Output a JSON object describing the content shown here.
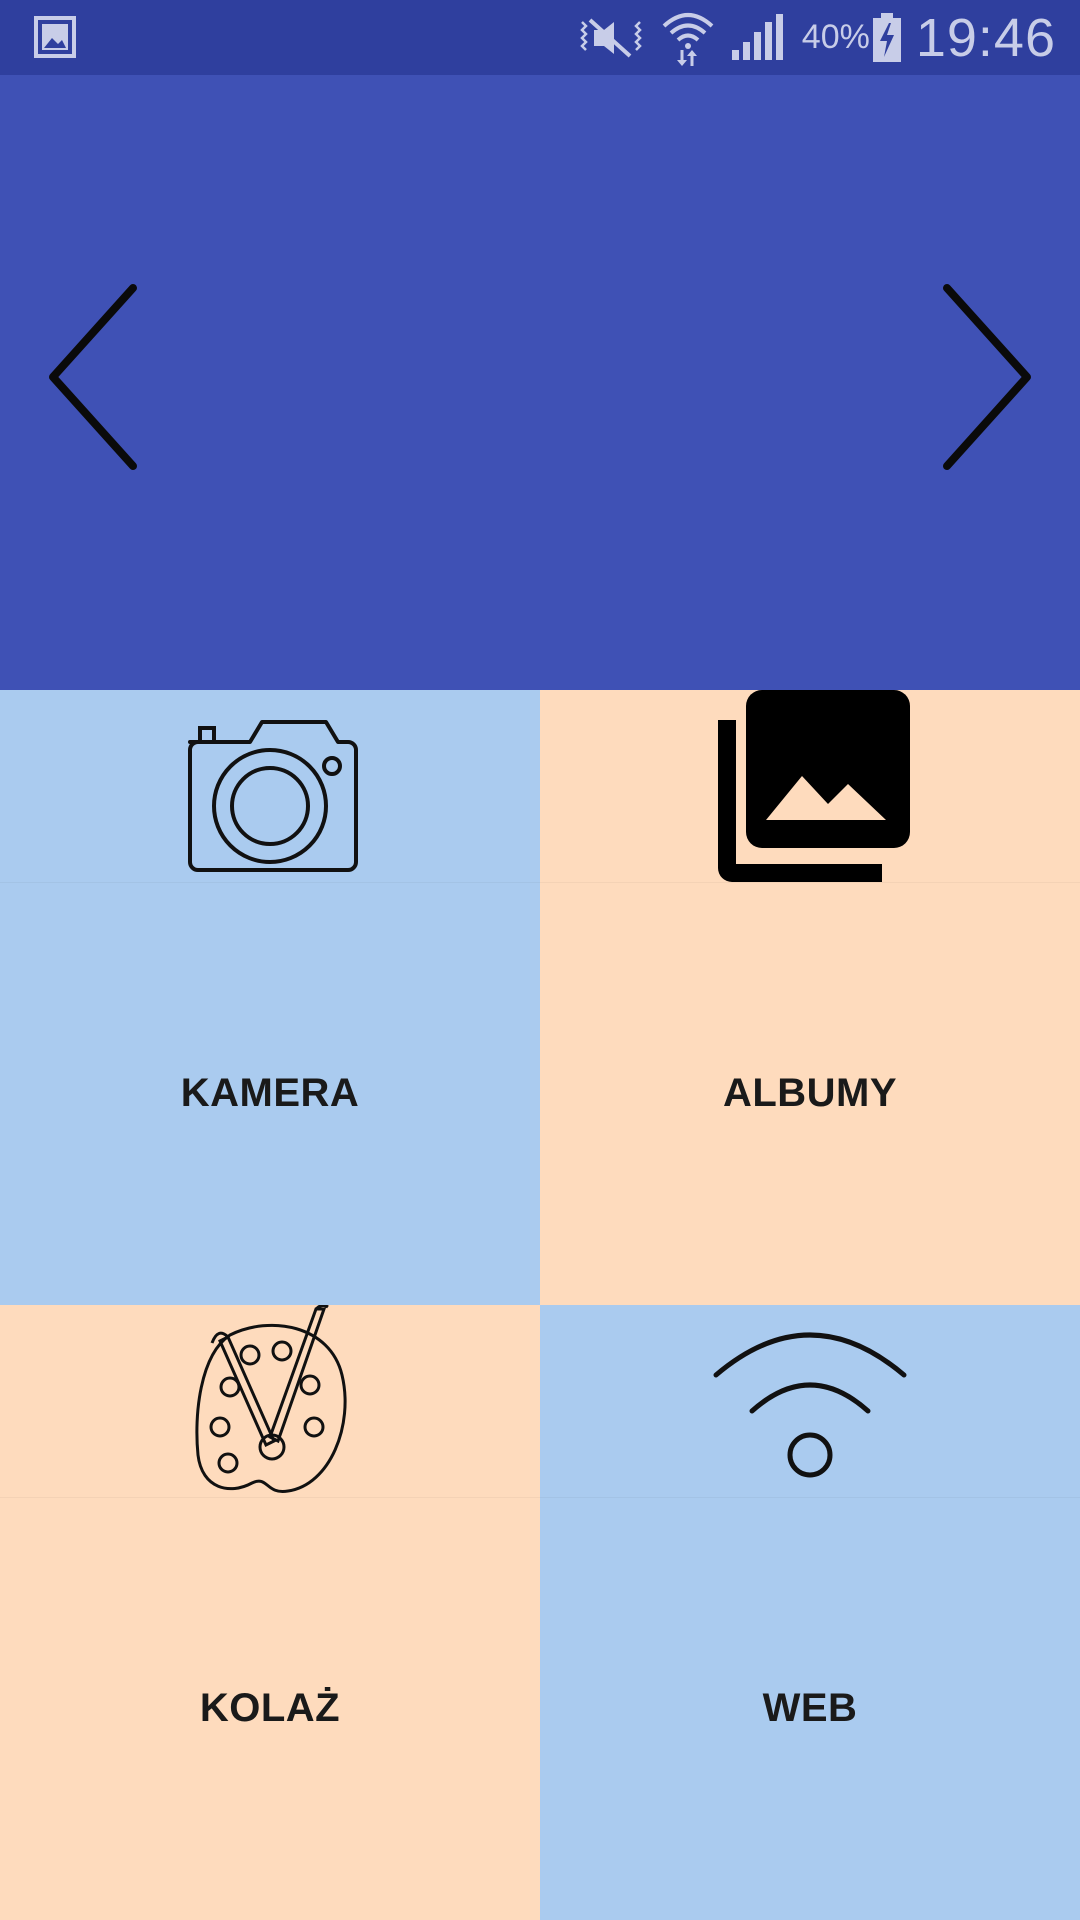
{
  "status_bar": {
    "notification_icon": "image-icon",
    "vibrate_icon": "vibrate-icon",
    "wifi_icon": "wifi-icon",
    "signal_icon": "signal-icon",
    "battery_percent": "40%",
    "battery_icon": "battery-charging-icon",
    "time": "19:46"
  },
  "banner": {
    "background_color": "#3f51b5",
    "prev_icon": "chevron-left-icon",
    "next_icon": "chevron-right-icon"
  },
  "tiles": [
    {
      "label": "KAMERA",
      "icon": "camera-icon",
      "color": "#aacbef"
    },
    {
      "label": "ALBUMY",
      "icon": "photo-library-icon",
      "color": "#fedbbd"
    },
    {
      "label": "KOLAŻ",
      "icon": "palette-icon",
      "color": "#fedbbd"
    },
    {
      "label": "WEB",
      "icon": "wifi-icon",
      "color": "#aacbef"
    }
  ]
}
